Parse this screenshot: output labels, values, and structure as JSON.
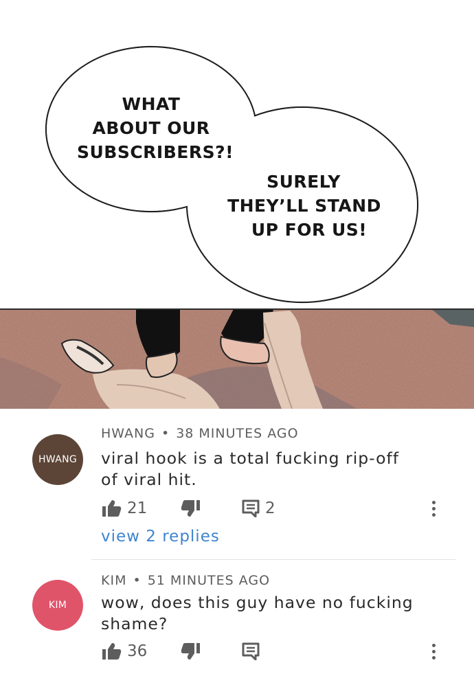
{
  "comic": {
    "bubble_left_lines": [
      "WHAT",
      "ABOUT OUR",
      "SUBSCRIBERS?!"
    ],
    "bubble_right_lines": [
      "SURELY",
      "THEY’LL STAND",
      "UP FOR US!"
    ]
  },
  "comments": [
    {
      "avatar_label": "HWANG",
      "avatar_color": "#5c4437",
      "author": "HWANG",
      "separator": "•",
      "time": "38 MINUTES AGO",
      "text": "viral hook is a total fucking rip-off of viral hit.",
      "likes": "21",
      "reply_count": "2",
      "view_replies": "view 2 replies"
    },
    {
      "avatar_label": "KIM",
      "avatar_color": "#e0546a",
      "author": "KIM",
      "separator": "•",
      "time": "51 MINUTES AGO",
      "text": "wow, does this guy have no fucking shame?",
      "likes": "36"
    }
  ],
  "icons": {
    "like": "thumbs-up-icon",
    "dislike": "thumbs-down-icon",
    "reply": "comment-icon",
    "more": "more-vertical-icon"
  }
}
